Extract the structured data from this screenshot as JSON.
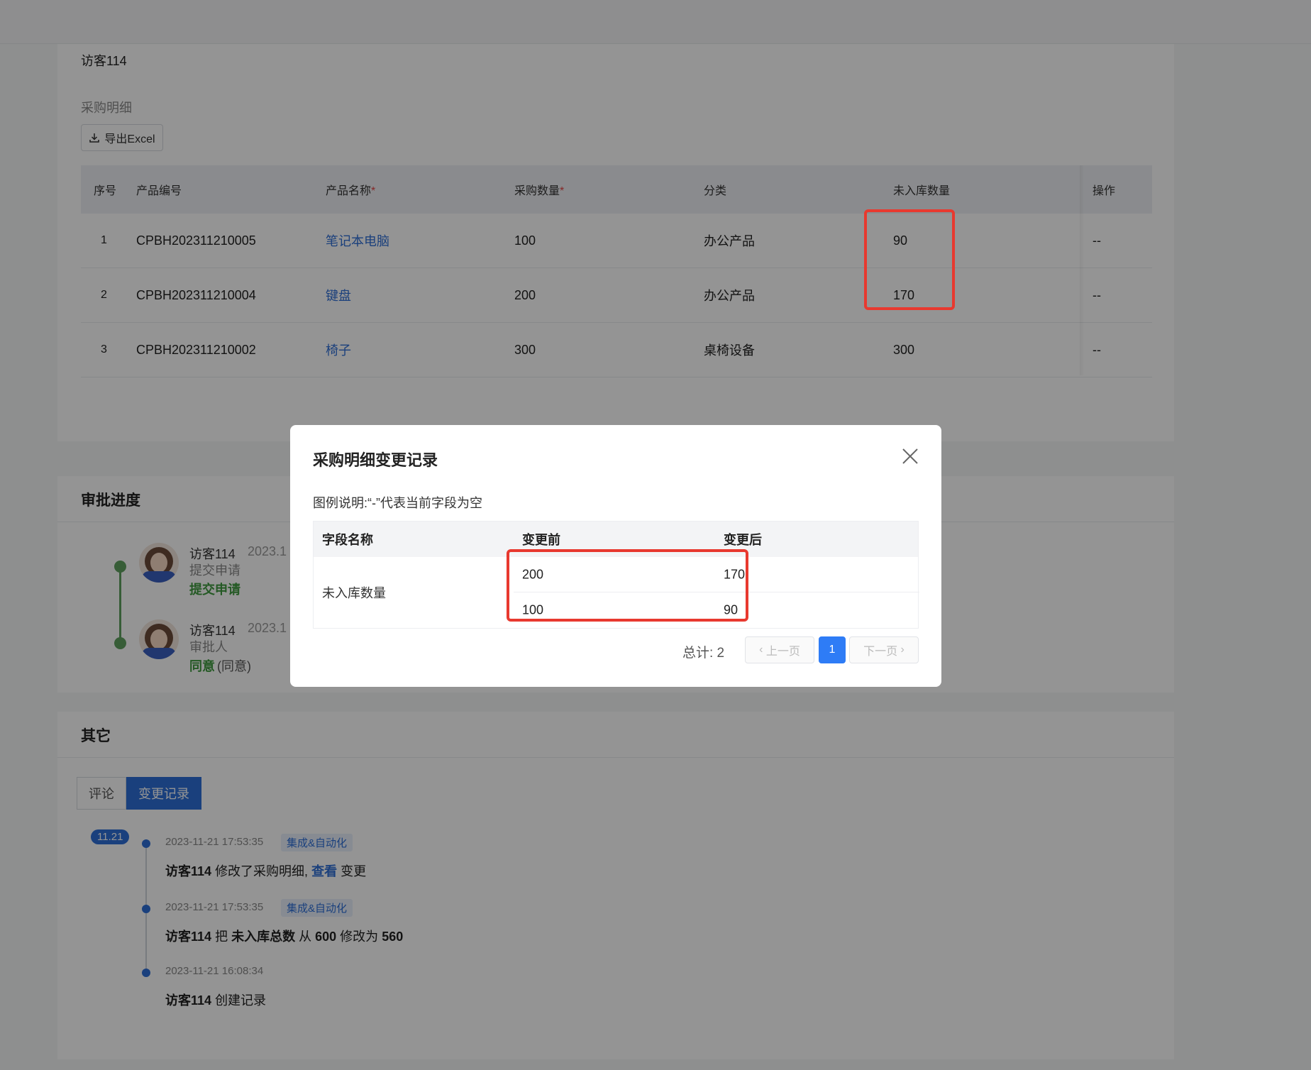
{
  "requester": "访客114",
  "detail": {
    "section_label": "采购明细",
    "export_label": "导出Excel",
    "columns": {
      "idx": "序号",
      "code": "产品编号",
      "name": "产品名称",
      "qty": "采购数量",
      "category": "分类",
      "uninbound": "未入库数量",
      "truncated": "",
      "op": "操作",
      "end": ""
    },
    "required_mark": "*",
    "rows": [
      {
        "idx": "1",
        "code": "CPBH202311210005",
        "name": "笔记本电脑",
        "qty": "100",
        "category": "办公产品",
        "uninbound": "90",
        "op": "--"
      },
      {
        "idx": "2",
        "code": "CPBH202311210004",
        "name": "键盘",
        "qty": "200",
        "category": "办公产品",
        "uninbound": "170",
        "op": "--"
      },
      {
        "idx": "3",
        "code": "CPBH202311210002",
        "name": "椅子",
        "qty": "300",
        "category": "桌椅设备",
        "uninbound": "300",
        "op": "--"
      }
    ]
  },
  "approval": {
    "title": "审批进度",
    "steps": [
      {
        "name": "访客114",
        "date": "2023.1",
        "sub": "提交申请",
        "status": "提交申请",
        "note": ""
      },
      {
        "name": "访客114",
        "date": "2023.1",
        "sub": "审批人",
        "status": "同意",
        "note": "(同意)"
      }
    ]
  },
  "other": {
    "title": "其它",
    "tabs": [
      {
        "label": "评论"
      },
      {
        "label": "变更记录"
      }
    ],
    "date_badge": "11.21",
    "logs": [
      {
        "time": "2023-11-21 17:53:35",
        "tag": "集成&自动化",
        "user": "访客114",
        "t1": "修改了采购明细,",
        "link": "查看",
        "t2": "变更"
      },
      {
        "time": "2023-11-21 17:53:35",
        "tag": "集成&自动化",
        "user": "访客114",
        "t1": "把",
        "field": "未入库总数",
        "from_word": "从",
        "from": "600",
        "to_word": "修改为",
        "to": "560"
      },
      {
        "time": "2023-11-21 16:08:34",
        "user": "访客114",
        "t1": "创建记录"
      }
    ]
  },
  "modal": {
    "title": "采购明细变更记录",
    "legend": "图例说明:“-”代表当前字段为空",
    "columns": {
      "field": "字段名称",
      "before": "变更前",
      "after": "变更后"
    },
    "field_name": "未入库数量",
    "rows": [
      {
        "before": "200",
        "after": "170"
      },
      {
        "before": "100",
        "after": "90"
      }
    ],
    "total": "总计: 2",
    "prev": "上一页",
    "current_page": "1",
    "next": "下一页"
  },
  "colors": {
    "primary": "#2e6fd8",
    "highlight": "#e8392f",
    "success": "#3f9a3f"
  }
}
